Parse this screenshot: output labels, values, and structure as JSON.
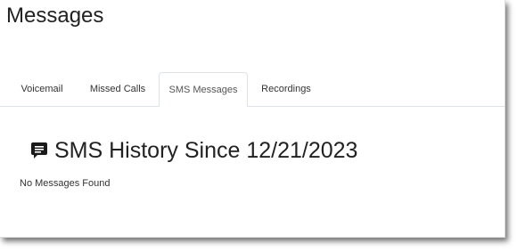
{
  "page": {
    "title": "Messages"
  },
  "tabs": [
    {
      "label": "Voicemail",
      "active": false
    },
    {
      "label": "Missed Calls",
      "active": false
    },
    {
      "label": "SMS Messages",
      "active": true
    },
    {
      "label": "Recordings",
      "active": false
    }
  ],
  "section": {
    "icon": "chat-bubble-icon",
    "title": "SMS History Since 12/21/2023",
    "empty_text": "No Messages Found"
  },
  "colors": {
    "text": "#222222",
    "border": "#dee2e6",
    "background": "#ffffff"
  }
}
